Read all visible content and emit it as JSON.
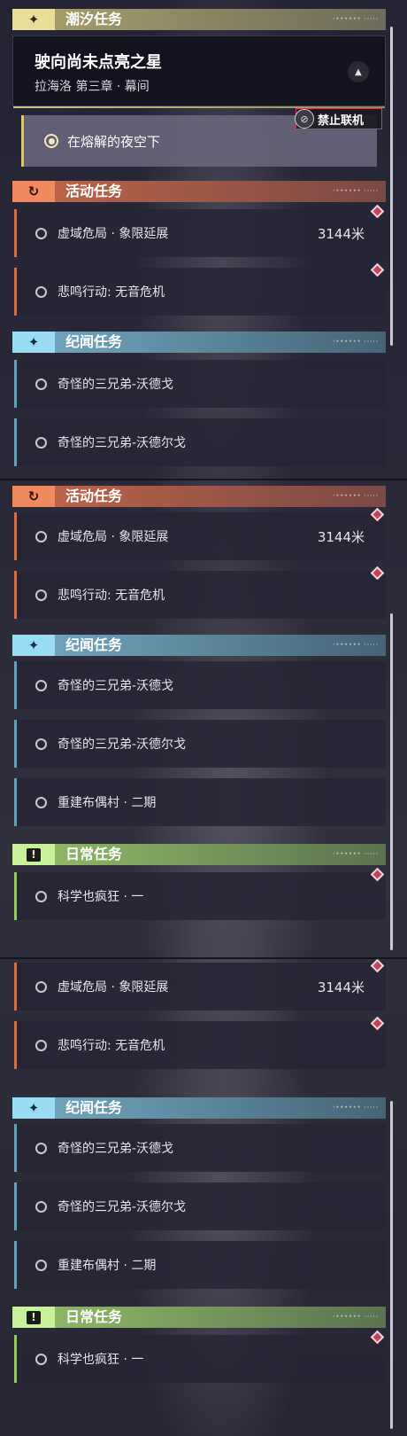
{
  "colors": {
    "tide": "#e9dd97",
    "event": "#f08a5e",
    "lore": "#99dcf3",
    "daily": "#c9f09a",
    "marker": "#c0455c"
  },
  "headers": {
    "tide": "潮汐任务",
    "event": "活动任务",
    "lore": "纪闻任务",
    "daily": "日常任务"
  },
  "main_quest": {
    "title": "驶向尚未点亮之星",
    "subtitle": "拉海洛 第三章 · 幕间",
    "objective": "在熔解的夜空下"
  },
  "coop_badge": "禁止联机",
  "icons": {
    "tide": "sparkle-icon",
    "event": "refresh-icon",
    "lore": "sparkle-icon",
    "daily": "alert-icon"
  },
  "quests": {
    "event_1": "虚域危局 · 象限延展",
    "event_1_distance": "3144米",
    "event_2": "悲鸣行动: 无音危机",
    "lore_1": "奇怪的三兄弟-沃德戈",
    "lore_2": "奇怪的三兄弟-沃德尔戈",
    "lore_3": "重建布偶村 · 二期",
    "daily_1": "科学也疯狂 · 一"
  }
}
